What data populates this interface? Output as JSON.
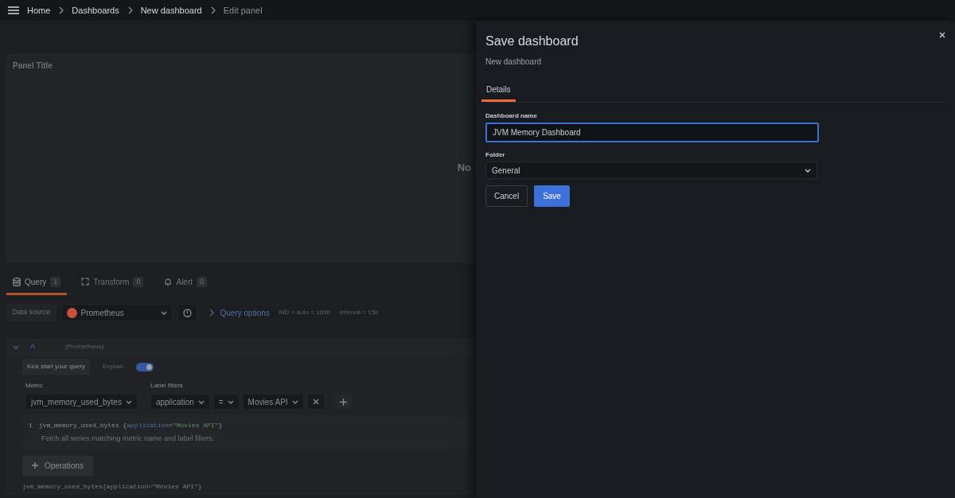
{
  "breadcrumbs": [
    {
      "label": "Home",
      "current": false
    },
    {
      "label": "Dashboards",
      "current": false
    },
    {
      "label": "New dashboard",
      "current": false
    },
    {
      "label": "Edit panel",
      "current": true
    }
  ],
  "panel": {
    "title": "Panel Title",
    "message": "No"
  },
  "editor_tabs": [
    {
      "label": "Query",
      "count": "1",
      "selected": true
    },
    {
      "label": "Transform",
      "count": "0",
      "selected": false
    },
    {
      "label": "Alert",
      "count": "0",
      "selected": false
    }
  ],
  "data_source": {
    "label": "Data source",
    "value": "Prometheus"
  },
  "query_options": {
    "label": "Query options",
    "details": [
      "MD = auto = 1696",
      "Interval = 15s"
    ]
  },
  "query": {
    "ref": "A",
    "source": "(Prometheus)",
    "kick_start": "Kick start your query",
    "explain": {
      "label": "Explain",
      "on": true
    },
    "metric": {
      "label": "Metric",
      "value": "jvm_memory_used_bytes"
    },
    "label_filters": {
      "label": "Label filters",
      "key": "application",
      "operator": "=",
      "value": "Movies API"
    },
    "code": {
      "line_number": "1",
      "segments": [
        {
          "kind": "metric",
          "text": "jvm_memory_used_bytes {"
        },
        {
          "kind": "label",
          "text": "application"
        },
        {
          "kind": "operator",
          "text": "="
        },
        {
          "kind": "string",
          "text": "\"Movies API\""
        },
        {
          "kind": "punct",
          "text": "}"
        }
      ]
    },
    "hint": "Fetch all series matching metric name and label filters.",
    "operations": "Operations",
    "raw": "jvm_memory_used_bytes{application=\"Movies API\"}"
  },
  "drawer": {
    "title": "Save dashboard",
    "subtitle": "New dashboard",
    "tabs": [
      {
        "label": "Details",
        "selected": true
      }
    ],
    "fields": [
      {
        "kind": "text",
        "label": "Dashboard name",
        "value": "JVM Memory Dashboard",
        "focused": true
      },
      {
        "kind": "select",
        "label": "Folder",
        "value": "General",
        "focused": false
      }
    ],
    "buttons": [
      {
        "label": "Cancel",
        "kind": "secondary"
      },
      {
        "label": "Save",
        "kind": "primary"
      }
    ]
  }
}
